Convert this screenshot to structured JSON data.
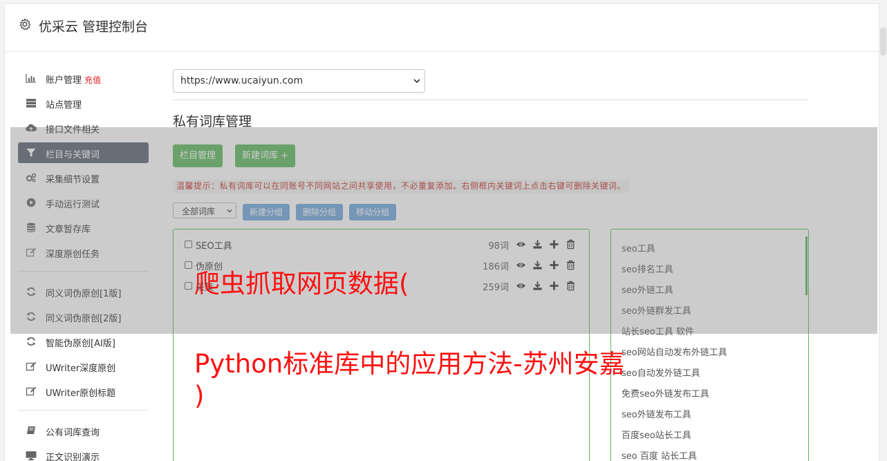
{
  "header": {
    "title": "优采云 管理控制台",
    "icon": "gear-icon"
  },
  "sidebar": {
    "items": [
      {
        "label": "账户管理",
        "badge": "充值",
        "icon": "bar-chart-icon"
      },
      {
        "label": "站点管理",
        "icon": "server-icon"
      },
      {
        "label": "接口文件相关",
        "icon": "cloud-upload-icon"
      },
      {
        "label": "栏目与关键词",
        "icon": "filter-icon",
        "active": true
      },
      {
        "label": "采集细节设置",
        "icon": "cogs-icon"
      },
      {
        "label": "手动运行测试",
        "icon": "play-circle-icon"
      },
      {
        "label": "文章暂存库",
        "icon": "database-icon"
      },
      {
        "label": "深度原创任务",
        "icon": "edit-icon"
      },
      {
        "label": "同义词伪原创[1版]",
        "icon": "refresh-icon"
      },
      {
        "label": "同义词伪原创[2版]",
        "icon": "refresh-icon"
      },
      {
        "label": "智能伪原创[AI版]",
        "icon": "refresh-icon"
      },
      {
        "label": "UWriter深度原创",
        "icon": "edit-icon"
      },
      {
        "label": "UWriter原创标题",
        "icon": "edit-icon"
      },
      {
        "label": "公有词库查询",
        "icon": "book-icon"
      },
      {
        "label": "正文识别演示",
        "icon": "monitor-icon"
      }
    ]
  },
  "main": {
    "site_select": "https://www.ucaiyun.com",
    "section_title": "私有词库管理",
    "buttons": {
      "column_manage": "栏目管理",
      "new_library": "新建词库 +"
    },
    "tip": "温馨提示：私有词库可以在同账号不同网站之间共享使用，不必重复添加。右侧框内关键词上点击右键可删除关键词。",
    "group_select": "全部词库",
    "group_buttons": {
      "new_group": "新建分组",
      "delete_group": "删除分组",
      "move_group": "移动分组"
    },
    "libraries": [
      {
        "name": "SEO工具",
        "count": "98词"
      },
      {
        "name": "伪原创",
        "count": "186词"
      },
      {
        "name": "采集",
        "count": "259词"
      }
    ],
    "keywords": [
      "seo工具",
      "seo排名工具",
      "seo外链工具",
      "seo外链群发工具",
      "站长seo工具 软件",
      "seo网站自动发布外链工具",
      "seo自动发外链工具",
      "免费seo外链发布工具",
      "seo外链发布工具",
      "百度seo站长工具",
      "seo 百度 站长工具"
    ]
  },
  "overlay": {
    "line1": "爬虫抓取网页数据(",
    "line2": "Python标准库中的应用方法-苏州安嘉",
    "line3": ")"
  },
  "colors": {
    "active_nav": "#5a6371",
    "green": "#5cb85c",
    "blue": "#6fa6dd",
    "headline": "#ff1010",
    "badge": "#e02020"
  }
}
